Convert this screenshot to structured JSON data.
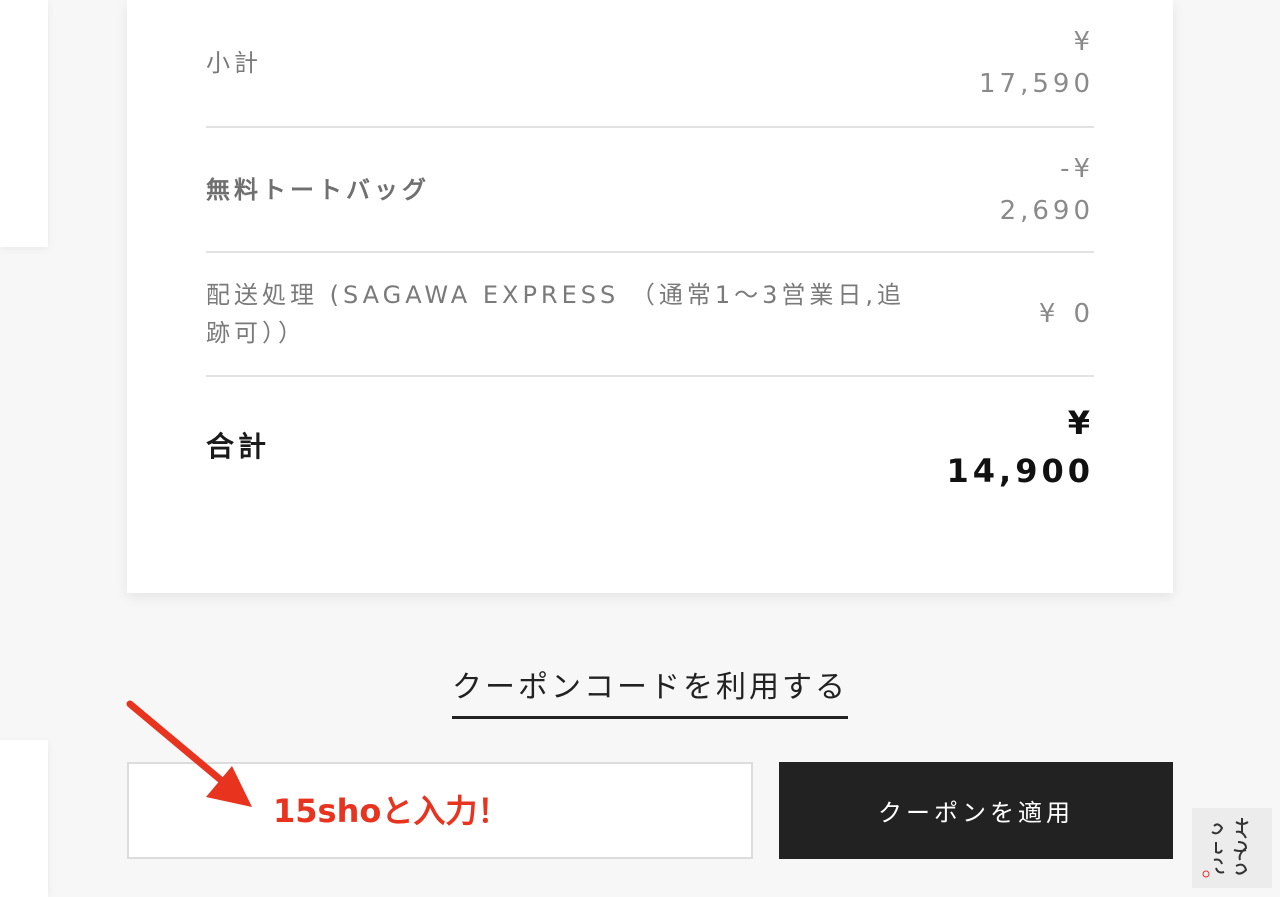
{
  "summary": {
    "subtotal": {
      "label": "小計",
      "currency": "¥",
      "amount": "17,590"
    },
    "discount": {
      "label": "無料トートバッグ",
      "currency": "-¥",
      "amount": "2,690"
    },
    "shipping": {
      "label": "配送処理 (SAGAWA EXPRESS （通常1～3営業日,追跡可））",
      "currency": "¥",
      "amount": "0"
    },
    "total": {
      "label": "合計",
      "currency": "¥",
      "amount": "14,900"
    }
  },
  "coupon": {
    "link_label": "クーポンコードを利用する",
    "input_value": "",
    "input_placeholder": "",
    "apply_label": "クーポンを適用"
  },
  "annotation": {
    "text": "15shoと入力！",
    "color": "#e8331f",
    "icon": "arrow-icon"
  },
  "watermark": {
    "text": "大きなひとりごと",
    "icon": "handwritten-logo"
  },
  "colors": {
    "button_bg": "#222222",
    "annotation": "#e8331f"
  }
}
